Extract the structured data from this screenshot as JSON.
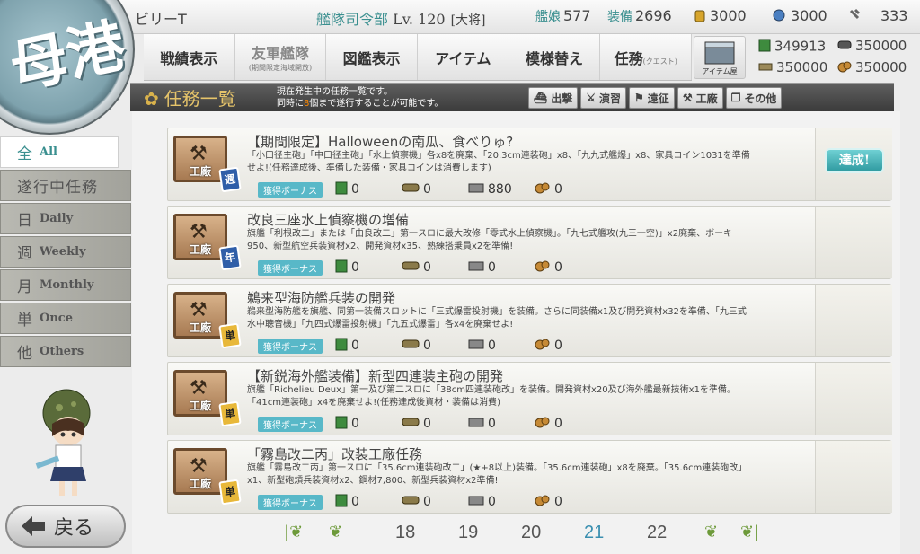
{
  "top": {
    "player": "ビリーT",
    "hq_label": "艦隊司令部",
    "hq_level": "Lv. 120",
    "rank": "[大将]",
    "ships_label": "艦娘",
    "ships": "577",
    "equip_label": "装備",
    "equip": "2696",
    "buckets": "3000",
    "devmats": "3000",
    "screws": "333"
  },
  "nav": [
    {
      "label": "戦績表示",
      "sub": ""
    },
    {
      "label": "友軍艦隊",
      "sub": "(期間限定海域開放)"
    },
    {
      "label": "図鑑表示",
      "sub": ""
    },
    {
      "label": "アイテム",
      "sub": ""
    },
    {
      "label": "模様替え",
      "sub": ""
    },
    {
      "label": "任務",
      "sub": "(クエスト)"
    }
  ],
  "item_shop_label": "アイテム屋",
  "resources": {
    "fuel": "349913",
    "ammo": "350000",
    "steel": "350000",
    "bauxite": "350000"
  },
  "header": {
    "title": "任務一覧",
    "desc_line1": "現在発生中の任務一覧です。",
    "desc_line2_pre": "同時に",
    "desc_line2_num": "8",
    "desc_line2_post": "個まで遂行することが可能です。"
  },
  "filters": [
    "出撃",
    "演習",
    "遠征",
    "工廠",
    "その他"
  ],
  "sidebar": [
    {
      "big": "全",
      "en": "All"
    },
    {
      "big": "遂行中任務",
      "en": ""
    },
    {
      "big": "日",
      "en": "Daily"
    },
    {
      "big": "週",
      "en": "Weekly"
    },
    {
      "big": "月",
      "en": "Monthly"
    },
    {
      "big": "単",
      "en": "Once"
    },
    {
      "big": "他",
      "en": "Others"
    }
  ],
  "back_label": "戻る",
  "bonus_label": "獲得ボーナス",
  "category_label": "工廠",
  "quests": [
    {
      "badge": "週",
      "title": "【期間限定】Halloweenの南瓜、食べりゅ?",
      "body": "「小口径主砲」「中口径主砲」「水上偵察機」各x8を廃棄、「20.3cm連装砲」x8、「九九式艦爆」x8、家具コイン1031を準備せよ!(任務達成後、準備した装備・家具コインは消費します)",
      "rewards": [
        "0",
        "0",
        "880",
        "0"
      ],
      "status": "達成!"
    },
    {
      "badge": "年",
      "title": "改良三座水上偵察機の増備",
      "body": "旗艦「利根改二」または「由良改二」第一スロに最大改修「零式水上偵察機」。「九七式艦攻(九三一空)」x2廃棄、ボーキ950、新型航空兵装資材x2、開発資材x35、熟練搭乗員x2を準備!",
      "rewards": [
        "0",
        "0",
        "0",
        "0"
      ],
      "status": ""
    },
    {
      "badge": "単",
      "title": "鵜来型海防艦兵装の開発",
      "body": "鵜来型海防艦を旗艦、同第一装備スロットに「三式爆雷投射機」を装備。さらに同装備x1及び開発資材x32を準備、「九三式水中聴音機」「九四式爆雷投射機」「九五式爆雷」各x4を廃棄せよ!",
      "rewards": [
        "0",
        "0",
        "0",
        "0"
      ],
      "status": ""
    },
    {
      "badge": "単",
      "title": "【新鋭海外艦装備】新型四連装主砲の開発",
      "body": "旗艦「Richelieu Deux」第一及び第二スロに「38cm四連装砲改」を装備。開発資材x20及び海外艦最新技術x1を準備。「41cm連装砲」x4を廃棄せよ!(任務達成後資材・装備は消費)",
      "rewards": [
        "0",
        "0",
        "0",
        "0"
      ],
      "status": ""
    },
    {
      "badge": "単",
      "title": "「霧島改二丙」改装工廠任務",
      "body": "旗艦「霧島改二丙」第一スロに「35.6cm連装砲改二」(★+8以上)装備。「35.6cm連装砲」x8を廃棄。「35.6cm連装砲改」x1、新型砲熕兵装資材x2、鋼材7,800、新型兵装資材x2準備!",
      "rewards": [
        "0",
        "0",
        "0",
        "0"
      ],
      "status": ""
    }
  ],
  "pages": [
    "18",
    "19",
    "20",
    "21",
    "22"
  ],
  "current_page": "21"
}
